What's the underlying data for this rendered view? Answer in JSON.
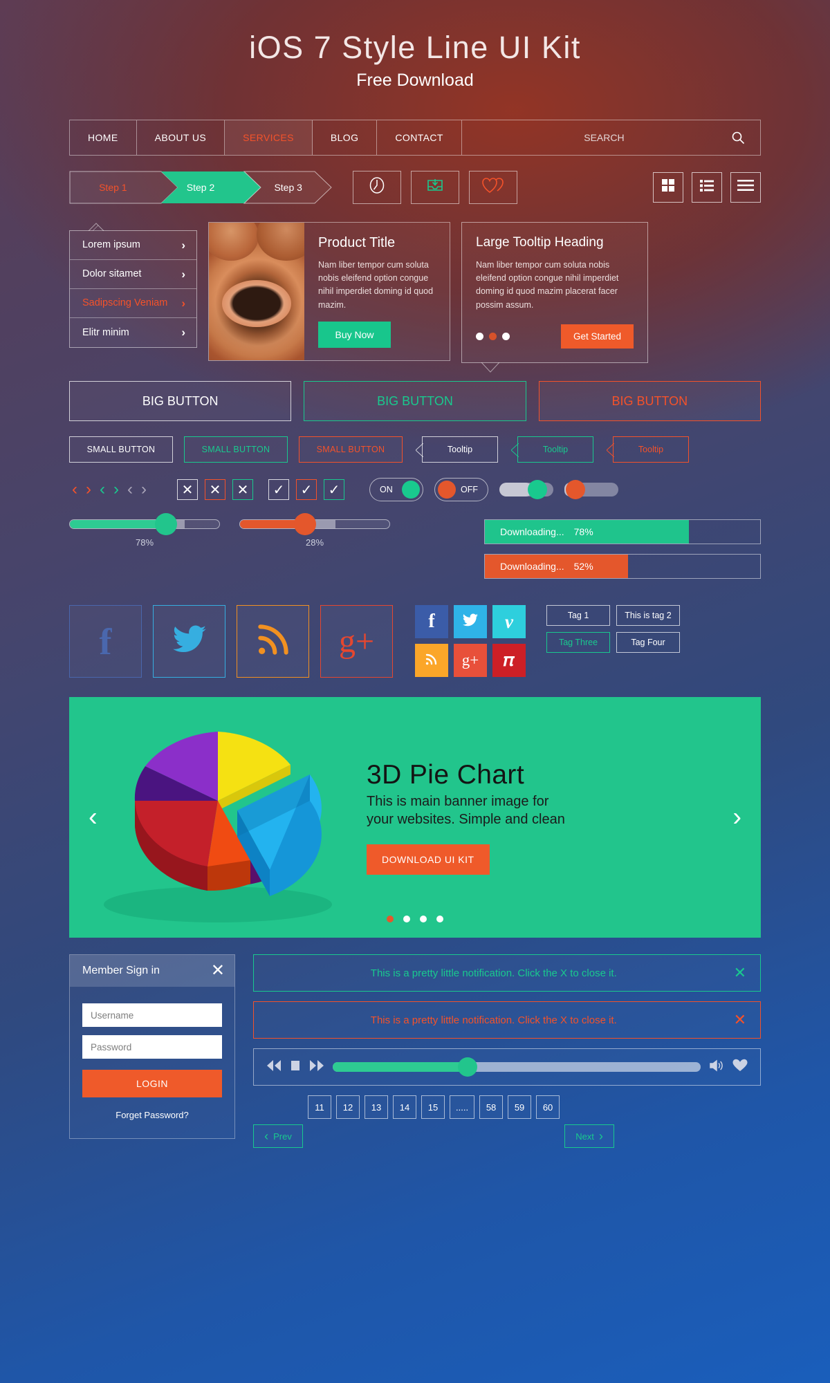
{
  "hero": {
    "title": "iOS 7 Style Line UI Kit",
    "subtitle": "Free Download"
  },
  "nav": {
    "items": [
      {
        "label": "HOME",
        "active": false
      },
      {
        "label": "ABOUT US",
        "active": false
      },
      {
        "label": "SERVICES",
        "active": true
      },
      {
        "label": "BLOG",
        "active": false
      },
      {
        "label": "CONTACT",
        "active": false
      }
    ],
    "search_label": "SEARCH",
    "search_icon": "search-icon"
  },
  "steps": [
    {
      "label": "Step 1",
      "state": "done"
    },
    {
      "label": "Step 2",
      "state": "active"
    },
    {
      "label": "Step 3",
      "state": "todo"
    }
  ],
  "icon_buttons": [
    {
      "name": "clock-icon"
    },
    {
      "name": "inbox-download-icon"
    },
    {
      "name": "double-heart-icon"
    }
  ],
  "view_buttons": [
    {
      "name": "grid-view-icon"
    },
    {
      "name": "list-view-icon"
    },
    {
      "name": "menu-lines-icon"
    }
  ],
  "dropdown": {
    "items": [
      {
        "label": "Lorem ipsum",
        "active": false
      },
      {
        "label": "Dolor sitamet",
        "active": false
      },
      {
        "label": "Sadipscing Veniam",
        "active": true
      },
      {
        "label": "Elitr minim",
        "active": false
      }
    ]
  },
  "product_card": {
    "title": "Product Title",
    "text": "Nam liber tempor cum soluta nobis eleifend option congue nihil imperdiet doming id quod mazim.",
    "button": "Buy Now"
  },
  "tooltip_card": {
    "title": "Large Tooltip Heading",
    "text": "Nam liber tempor cum soluta nobis eleifend option congue nihil imperdiet doming id quod mazim placerat facer possim assum.",
    "button": "Get Started",
    "dots": [
      false,
      true,
      false
    ]
  },
  "big_buttons": [
    {
      "label": "BIG BUTTON",
      "style": "white"
    },
    {
      "label": "BIG BUTTON",
      "style": "green"
    },
    {
      "label": "BIG BUTTON",
      "style": "orange"
    }
  ],
  "small_buttons": [
    {
      "label": "SMALL BUTTON",
      "style": "white"
    },
    {
      "label": "SMALL BUTTON",
      "style": "green"
    },
    {
      "label": "SMALL BUTTON",
      "style": "orange"
    }
  ],
  "tooltips": [
    {
      "label": "Tooltip",
      "style": "white"
    },
    {
      "label": "Tooltip",
      "style": "green"
    },
    {
      "label": "Tooltip",
      "style": "orange"
    }
  ],
  "arrows": [
    {
      "name": "chevron-left-icon",
      "glyph": "‹",
      "color": "orange"
    },
    {
      "name": "chevron-right-icon",
      "glyph": "›",
      "color": "orange"
    },
    {
      "name": "chevron-left-icon",
      "glyph": "‹",
      "color": "green"
    },
    {
      "name": "chevron-right-icon",
      "glyph": "›",
      "color": "green"
    },
    {
      "name": "chevron-left-icon",
      "glyph": "‹",
      "color": "gray"
    },
    {
      "name": "chevron-right-icon",
      "glyph": "›",
      "color": "gray"
    }
  ],
  "checkboxes": [
    {
      "glyph": "✕",
      "border": "white"
    },
    {
      "glyph": "✕",
      "border": "orange"
    },
    {
      "glyph": "✕",
      "border": "green"
    },
    {
      "glyph": "✓",
      "border": "white"
    },
    {
      "glyph": "✓",
      "border": "orange"
    },
    {
      "glyph": "✓",
      "border": "green"
    }
  ],
  "toggles": [
    {
      "label": "ON",
      "state": "on"
    },
    {
      "label": "OFF",
      "state": "off"
    }
  ],
  "sliders": [
    {
      "value": "78%",
      "color": "green"
    },
    {
      "value": "28%",
      "color": "orange"
    }
  ],
  "downloads": [
    {
      "label": "Downloading...",
      "value": "78%",
      "color": "green"
    },
    {
      "label": "Downloading...",
      "value": "52%",
      "color": "orange"
    }
  ],
  "social_outline": [
    {
      "name": "facebook-icon",
      "glyph": "f"
    },
    {
      "name": "twitter-icon",
      "glyph": ""
    },
    {
      "name": "rss-icon",
      "glyph": ""
    },
    {
      "name": "google-plus-icon",
      "glyph": "g+"
    }
  ],
  "social_solid": [
    {
      "name": "facebook-icon",
      "color": "#3b5ca8"
    },
    {
      "name": "twitter-icon",
      "color": "#2fb3e8"
    },
    {
      "name": "vimeo-icon",
      "color": "#2ecfdd"
    },
    {
      "name": "rss-icon",
      "color": "#fba629"
    },
    {
      "name": "google-plus-icon",
      "color": "#e8503a"
    },
    {
      "name": "pinterest-icon",
      "color": "#cd1f26"
    }
  ],
  "tags": [
    {
      "label": "Tag 1",
      "style": "white"
    },
    {
      "label": "This is tag 2",
      "style": "white"
    },
    {
      "label": "Tag Three",
      "style": "green"
    },
    {
      "label": "Tag Four",
      "style": "white"
    }
  ],
  "banner": {
    "title": "3D Pie Chart",
    "subtitle": "This is main banner image for your websites. Simple and clean",
    "button": "DOWNLOAD UI KIT",
    "prev_icon": "chevron-left-icon",
    "next_icon": "chevron-right-icon",
    "dots": [
      true,
      false,
      false,
      false
    ],
    "bg_color": "#22c58c"
  },
  "login": {
    "title": "Member Sign in",
    "close_icon": "close-icon",
    "username_placeholder": "Username",
    "password_placeholder": "Password",
    "button": "LOGIN",
    "forget": "Forget Password?"
  },
  "notifications": [
    {
      "message": "This is a pretty little notification. Click the X to close it.",
      "style": "green",
      "close_icon": "close-icon"
    },
    {
      "message": "This is a pretty little notification. Click the X to close it.",
      "style": "orange",
      "close_icon": "close-icon"
    }
  ],
  "player": {
    "rewind_icon": "rewind-icon",
    "stop_icon": "stop-icon",
    "forward_icon": "fast-forward-icon",
    "volume_icon": "volume-icon",
    "heart_icon": "heart-icon"
  },
  "pagination": {
    "prev": "Prev",
    "next": "Next",
    "pages": [
      "11",
      "12",
      "13",
      "14",
      "15",
      ".....",
      "58",
      "59",
      "60"
    ]
  },
  "chart_data": {
    "type": "pie",
    "title": "3D Pie Chart",
    "categories": [
      "Yellow",
      "Purple",
      "Dark Violet",
      "Red",
      "Orange",
      "Cyan"
    ],
    "values": [
      17,
      15,
      13,
      16,
      9,
      30
    ],
    "colors": [
      "#f5e112",
      "#8b2fc9",
      "#4a1480",
      "#c4202a",
      "#f04b12",
      "#23b3ef"
    ],
    "legend": "none"
  },
  "colors": {
    "orange": "#f4522a",
    "green": "#19c98e",
    "banner_green": "#22c58c",
    "cta_orange": "#ef5a2a",
    "login_blue": "#1f5fbf"
  }
}
